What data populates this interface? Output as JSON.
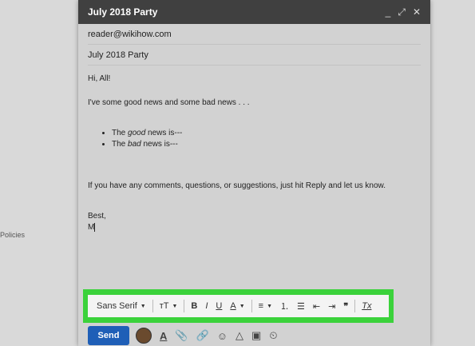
{
  "window": {
    "title": "July 2018 Party",
    "controls": [
      "minimize-icon",
      "expand-icon",
      "close-icon"
    ]
  },
  "fields": {
    "to": "reader@wikihow.com",
    "subject": "July 2018 Party"
  },
  "message": {
    "greeting": "Hi, All!",
    "line1": "I've some good news and some bad news . . .",
    "bullets": [
      {
        "prefix": "The ",
        "emph": "good",
        "suffix": " news is---"
      },
      {
        "prefix": "The ",
        "emph": "bad",
        "suffix": " news is---"
      }
    ],
    "line2": "If you have any comments, questions, or suggestions, just hit Reply and let us know.",
    "signoff": "Best,",
    "signature": "M"
  },
  "toolbar": {
    "font": "Sans Serif",
    "highlight_color": "#3bd23b",
    "buttons": [
      "font-size-icon",
      "bold-icon",
      "italic-icon",
      "underline-icon",
      "text-color-icon",
      "align-icon",
      "numbered-list-icon",
      "bulleted-list-icon",
      "indent-less-icon",
      "indent-more-icon",
      "quote-icon",
      "remove-formatting-icon"
    ],
    "glyphs": {
      "font_size": "тT",
      "bold": "B",
      "italic": "I",
      "underline": "U",
      "text_color": "A",
      "quote": "❞",
      "clear": "Tx"
    }
  },
  "bottombar": {
    "send_label": "Send",
    "send_color": "#1f5fb7"
  },
  "background": {
    "left_text": "Policies"
  }
}
